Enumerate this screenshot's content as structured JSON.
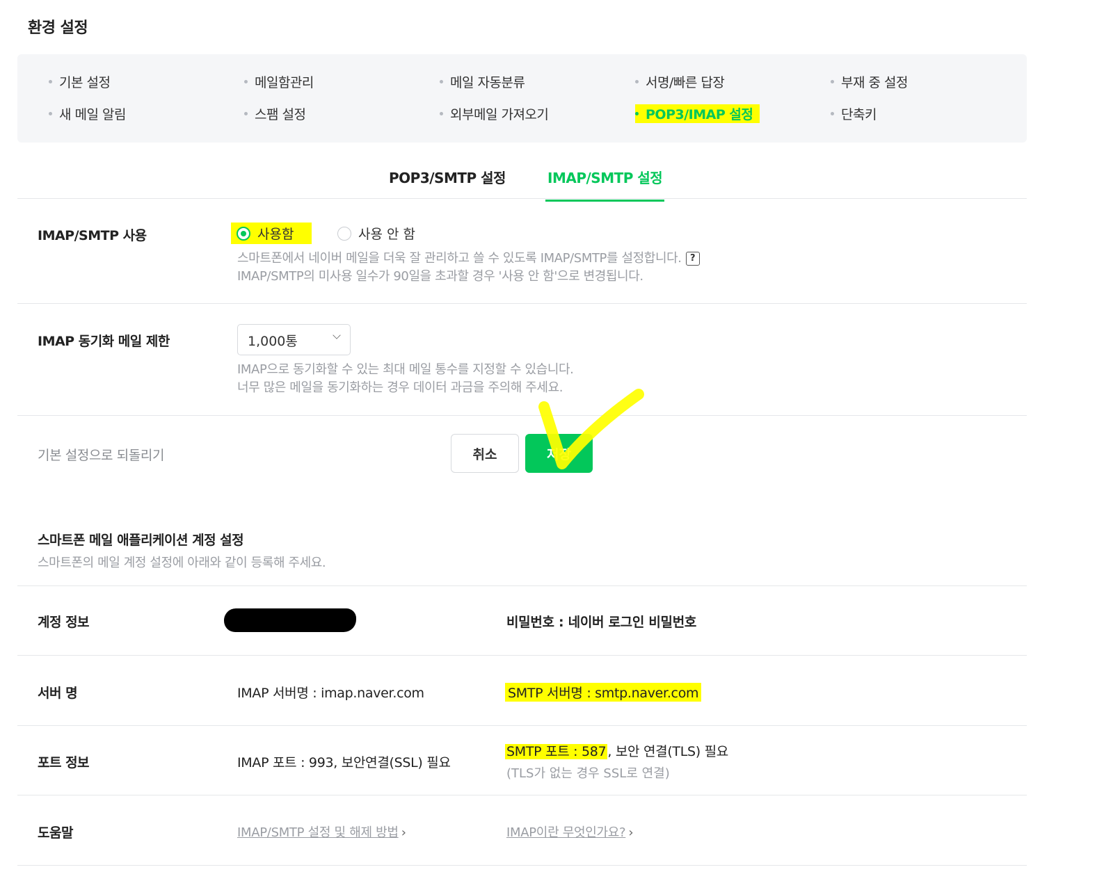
{
  "page": {
    "title": "환경 설정"
  },
  "menu": {
    "items": [
      {
        "label": "기본 설정",
        "active": false
      },
      {
        "label": "메일함관리",
        "active": false
      },
      {
        "label": "메일 자동분류",
        "active": false
      },
      {
        "label": "서명/빠른 답장",
        "active": false
      },
      {
        "label": "부재 중 설정",
        "active": false
      },
      {
        "label": "새 메일 알림",
        "active": false
      },
      {
        "label": "스팸 설정",
        "active": false
      },
      {
        "label": "외부메일 가져오기",
        "active": false
      },
      {
        "label": "POP3/IMAP 설정",
        "active": true
      },
      {
        "label": "단축키",
        "active": false
      }
    ]
  },
  "subtabs": [
    {
      "label": "POP3/SMTP 설정",
      "active": false
    },
    {
      "label": "IMAP/SMTP 설정",
      "active": true
    }
  ],
  "imap_use": {
    "label": "IMAP/SMTP 사용",
    "options": [
      {
        "label": "사용함",
        "checked": true
      },
      {
        "label": "사용 안 함",
        "checked": false
      }
    ],
    "help_1": "스마트폰에서 네이버 메일을 더욱 잘 관리하고 쓸 수 있도록 IMAP/SMTP를 설정합니다.",
    "help_icon": "?",
    "help_2": "IMAP/SMTP의 미사용 일수가 90일을 초과할 경우 '사용 안 함'으로 변경됩니다."
  },
  "sync_limit": {
    "label": "IMAP 동기화 메일 제한",
    "selected": "1,000통",
    "help_1": "IMAP으로 동기화할 수 있는 최대 메일 통수를 지정할 수 있습니다.",
    "help_2": "너무 많은 메일을 동기화하는 경우 데이터 과금을 주의해 주세요."
  },
  "actions": {
    "reset": "기본 설정으로 되돌리기",
    "cancel": "취소",
    "save": "저장"
  },
  "account_section": {
    "title": "스마트폰 메일 애플리케이션 계정 설정",
    "desc": "스마트폰의 메일 계정 설정에 아래와 같이 등록해 주세요.",
    "rows": {
      "account": {
        "label": "계정 정보",
        "right": "비밀번호 : 네이버 로그인 비밀번호"
      },
      "server": {
        "label": "서버 명",
        "left": "IMAP 서버명 : imap.naver.com",
        "right": "SMTP 서버명 : smtp.naver.com"
      },
      "port": {
        "label": "포트 정보",
        "left": "IMAP 포트 : 993, 보안연결(SSL) 필요",
        "right_hl": "SMTP 포트 : 587",
        "right_rest": ", 보안 연결(TLS) 필요",
        "right_sub": "(TLS가 없는 경우 SSL로 연결)"
      },
      "help": {
        "label": "도움말",
        "link_1": "IMAP/SMTP 설정 및 해제 방법",
        "link_2": "IMAP이란 무엇인가요?"
      }
    }
  },
  "colors": {
    "accent": "#03c75a",
    "highlight": "#ffff00",
    "menu_bg": "#f5f6f8"
  },
  "icons": {
    "chevron": "chevron-down-icon",
    "arrow": "chevron-right-icon",
    "help": "question-icon"
  }
}
